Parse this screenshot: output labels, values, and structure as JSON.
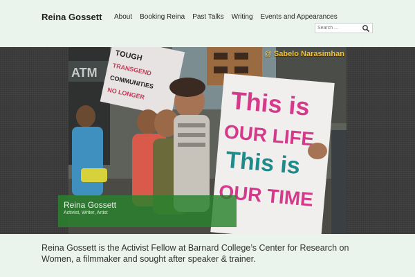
{
  "site": {
    "title": "Reina Gossett"
  },
  "nav": {
    "items": [
      "About",
      "Booking Reina",
      "Past Talks",
      "Writing",
      "Events and Appearances"
    ]
  },
  "search": {
    "placeholder": "Search ..."
  },
  "hero": {
    "credit": "@ Sabelo Narasimhan",
    "sign_back": "TOUGH\nERS\nNO\nTRANSGEND\nCOMMUNITIES\nNO LONGER",
    "sign_front": [
      "This is",
      "OUR LIFE",
      "This is",
      "OUR TIME"
    ],
    "storefront": "ATM",
    "caption_title": "Reina Gossett",
    "caption_subtitle": "Activist, Writer, Artist"
  },
  "intro": {
    "text": "Reina Gossett is the Activist Fellow at Barnard College’s Center for Research on Women, a filmmaker and sought after speaker & trainer."
  },
  "colors": {
    "header_bg": "#eaf4ed",
    "caption_bg": "#2e8a31",
    "credit": "#f2c23a",
    "sign_pink": "#d43a8a"
  }
}
